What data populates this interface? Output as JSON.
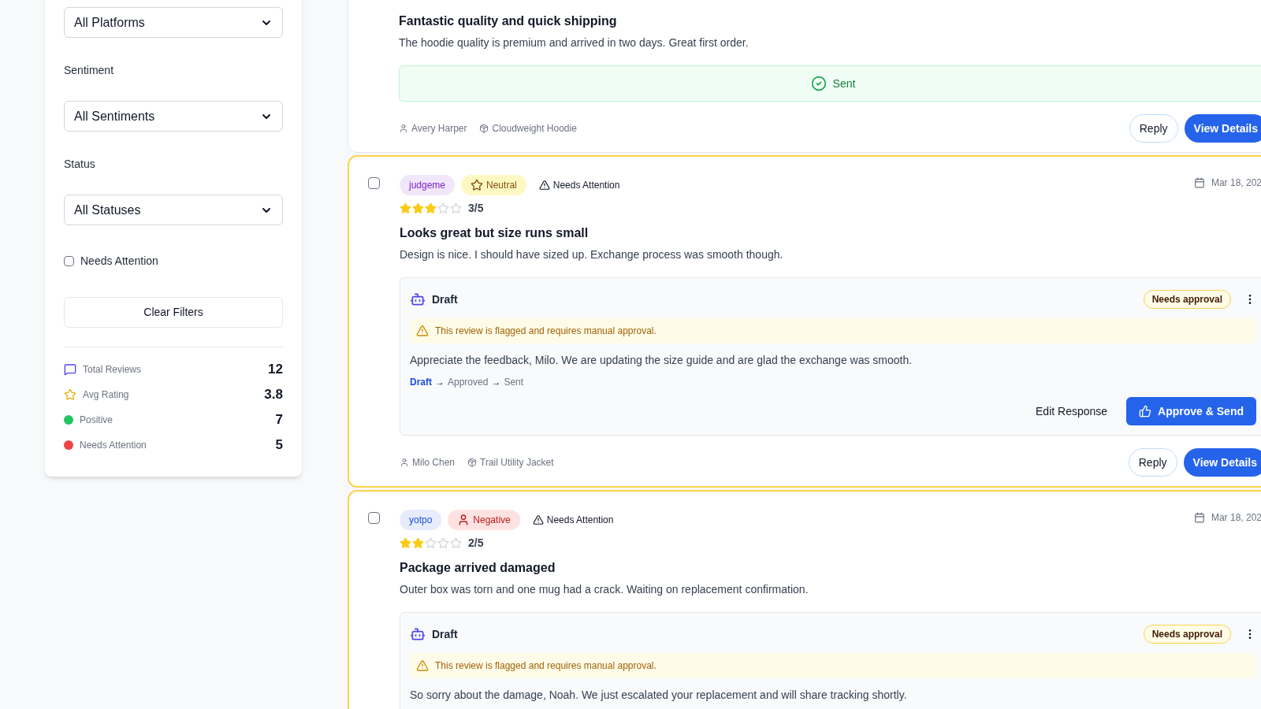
{
  "filters": {
    "selects": [
      {
        "value": "All Platforms"
      },
      {
        "label": "Sentiment",
        "value": "All Sentiments"
      },
      {
        "label": "Status",
        "value": "All Statuses"
      }
    ],
    "attention_checkbox": {
      "label": "Needs Attention",
      "checked": false
    },
    "clear_button": "Clear Filters",
    "stats": [
      {
        "kind": "message",
        "label": "Total Reviews",
        "value": "12"
      },
      {
        "kind": "star",
        "label": "Avg Rating",
        "value": "3.8"
      },
      {
        "kind": "dot",
        "color": "#22c55e",
        "label": "Positive",
        "value": "7"
      },
      {
        "kind": "dot",
        "color": "#ef4444",
        "label": "Needs Attention",
        "value": "5"
      }
    ]
  },
  "reviews": [
    {
      "needs_attention": false,
      "title": "Fantastic quality and quick shipping",
      "body": "The hoodie quality is premium and arrived in two days. Great first order.",
      "response": {
        "kind": "sent",
        "label": "Sent"
      },
      "author": "Avery Harper",
      "product": "Cloudweight Hoodie",
      "actions": [
        "Reply",
        "View Details"
      ]
    },
    {
      "needs_attention": true,
      "checked": false,
      "platform": {
        "label": "judgeme",
        "color": "#7e22ce"
      },
      "sentiment": {
        "kind": "neutral",
        "label": "Neutral"
      },
      "flag": "Needs Attention",
      "date": "Mar 18, 202",
      "stars": 3,
      "rating": "3/5",
      "title": "Looks great but size runs small",
      "body": "Design is nice. I should have sized up. Exchange process was smooth though.",
      "response": {
        "kind": "draft",
        "label": "Draft",
        "badge": "Needs approval",
        "warning": "This review is flagged and requires manual approval.",
        "text": "Appreciate the feedback, Milo. We are updating the size guide and are glad the exchange was smooth.",
        "steps": [
          {
            "label": "Draft",
            "selected": true
          },
          {
            "separator": "→",
            "label": "Approved",
            "selected": false
          },
          {
            "separator": "→",
            "label": "Sent",
            "selected": false
          }
        ],
        "buttons": [
          "Edit Response",
          "Approve & Send"
        ]
      },
      "author": "Milo Chen",
      "product": "Trail Utility Jacket",
      "actions": [
        "Reply",
        "View Details"
      ]
    },
    {
      "needs_attention": true,
      "checked": false,
      "platform": {
        "label": "yotpo",
        "color": "#1d4ed8"
      },
      "sentiment": {
        "kind": "negative",
        "label": "Negative"
      },
      "flag": "Needs Attention",
      "date": "Mar 18, 202",
      "stars": 2,
      "rating": "2/5",
      "title": "Package arrived damaged",
      "body": "Outer box was torn and one mug had a crack. Waiting on replacement confirmation.",
      "response": {
        "kind": "draft",
        "label": "Draft",
        "badge": "Needs approval",
        "warning": "This review is flagged and requires manual approval.",
        "text": "So sorry about the damage, Noah. We just escalated your replacement and will share tracking shortly."
      }
    }
  ]
}
